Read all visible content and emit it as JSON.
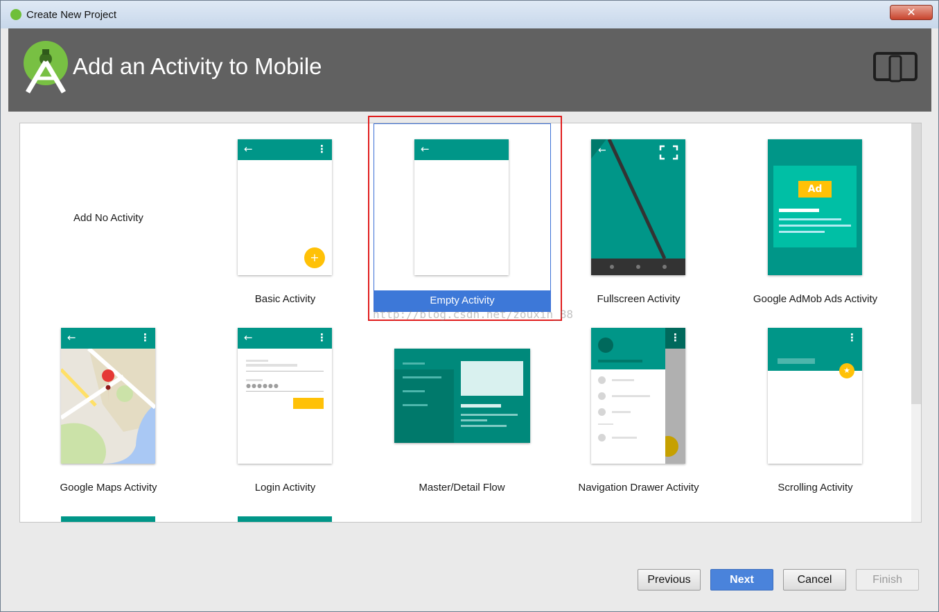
{
  "window": {
    "title": "Create New Project",
    "close_glyph": "✕"
  },
  "header": {
    "title": "Add an Activity to Mobile"
  },
  "templates": [
    {
      "label": "Add No Activity"
    },
    {
      "label": "Basic Activity"
    },
    {
      "label": "Empty Activity",
      "selected": true
    },
    {
      "label": "Fullscreen Activity"
    },
    {
      "label": "Google AdMob Ads Activity",
      "ad_badge": "Ad"
    },
    {
      "label": "Google Maps Activity"
    },
    {
      "label": "Login Activity"
    },
    {
      "label": "Master/Detail Flow"
    },
    {
      "label": "Navigation Drawer Activity"
    },
    {
      "label": "Scrolling Activity"
    }
  ],
  "watermark": "http://blog.csdn.net/zouxin_88",
  "buttons": {
    "previous": "Previous",
    "next": "Next",
    "cancel": "Cancel",
    "finish": "Finish"
  },
  "colors": {
    "teal": "#009688",
    "accent": "#ffc107",
    "selection": "#3d78d8",
    "highlight_box": "#e01b1b"
  },
  "icons": {
    "app": "android-studio-icon",
    "device": "phone-tablet-icon"
  }
}
